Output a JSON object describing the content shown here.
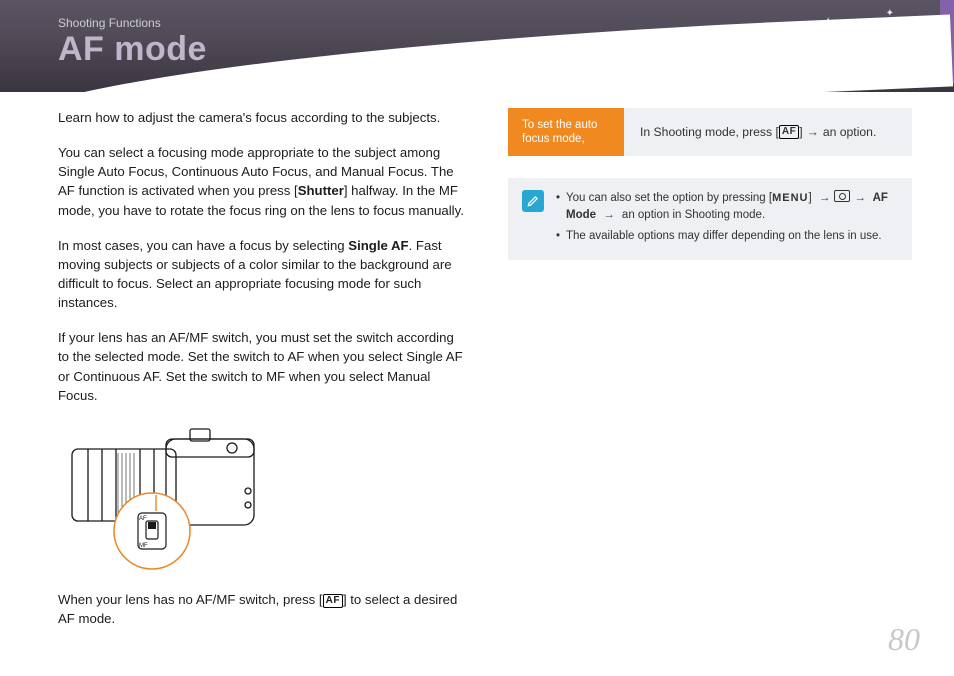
{
  "breadcrumb": "Shooting Functions",
  "title": "AF mode",
  "page_number": "80",
  "left": {
    "p1": "Learn how to adjust the camera's focus according to the subjects.",
    "p2_a": "You can select a focusing mode appropriate to the subject among Single Auto Focus, Continuous Auto Focus, and Manual Focus. The AF function is activated when you press [",
    "p2_shutter": "Shutter",
    "p2_b": "] halfway. In the MF mode, you have to rotate the focus ring on the lens to focus manually.",
    "p3_a": "In most cases, you can have a focus by selecting ",
    "p3_single": "Single AF",
    "p3_b": ". Fast moving subjects or subjects of a color similar to the background are difficult to focus. Select an appropriate focusing mode for such instances.",
    "p4": "If your lens has an AF/MF switch, you must set the switch according to the selected mode. Set the switch to AF when you select Single AF or Continuous AF. Set the switch to MF when you select Manual Focus.",
    "p5_a": "When your lens has no AF/MF switch, press [",
    "p5_af": "AF",
    "p5_b": "] to select a desired AF mode."
  },
  "callout": {
    "label": "To set the auto focus mode,",
    "instr_a": "In Shooting mode, press [",
    "instr_af": "AF",
    "instr_b": "] ",
    "instr_arrow": "→",
    "instr_c": " an option."
  },
  "note": {
    "li1_a": "You can also set the option by pressing [",
    "li1_menu": "MENU",
    "li1_b": "] ",
    "li1_arrow1": "→",
    "li1_c": " ",
    "li1_arrow2": "→",
    "li1_afmode": " AF Mode ",
    "li1_arrow3": "→",
    "li1_d": " an option in Shooting mode.",
    "li2": "The available options may differ depending on the lens in use."
  }
}
